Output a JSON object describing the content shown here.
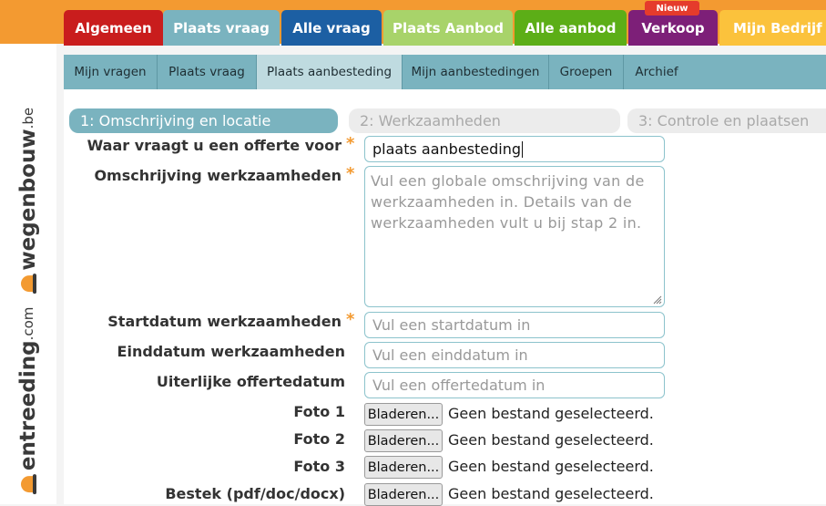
{
  "logo": {
    "part1": "entreeding",
    "part1_ext": ".com",
    "part2": "wegenbouw",
    "part2_ext": ".be"
  },
  "main_tabs": [
    {
      "label": "Algemeen",
      "color": "#c91d1d"
    },
    {
      "label": "Plaats vraag",
      "color": "#7ab3bf"
    },
    {
      "label": "Alle vraag",
      "color": "#1c5fa3"
    },
    {
      "label": "Plaats Aanbod",
      "color": "#a8d36a"
    },
    {
      "label": "Alle aanbod",
      "color": "#5cae17"
    },
    {
      "label": "Verkoop",
      "color": "#7d1f78"
    },
    {
      "label": "Mijn Bedrijf",
      "color": "#fbc23c"
    }
  ],
  "new_badge": "Nieuw",
  "sub_nav": [
    {
      "label": "Mijn vragen",
      "active": false
    },
    {
      "label": "Plaats vraag",
      "active": false
    },
    {
      "label": "Plaats aanbesteding",
      "active": true
    },
    {
      "label": "Mijn aanbestedingen",
      "active": false
    },
    {
      "label": "Groepen",
      "active": false
    },
    {
      "label": "Archief",
      "active": false
    }
  ],
  "steps": [
    {
      "label": "1: Omschrijving en locatie",
      "active": true
    },
    {
      "label": "2: Werkzaamheden",
      "active": false
    },
    {
      "label": "3: Controle en plaatsen",
      "active": false
    }
  ],
  "form": {
    "required_mark": "*",
    "offerte_voor": {
      "label": "Waar vraagt u een offerte voor",
      "value": "plaats aanbesteding"
    },
    "omschrijving": {
      "label": "Omschrijving werkzaamheden",
      "placeholder": "Vul een globale omschrijving van de werkzaamheden in. Details van de werkzaamheden vult u bij stap 2 in."
    },
    "startdatum": {
      "label": "Startdatum werkzaamheden",
      "placeholder": "Vul een startdatum in"
    },
    "einddatum": {
      "label": "Einddatum werkzaamheden",
      "placeholder": "Vul een einddatum in"
    },
    "offertedatum": {
      "label": "Uiterlijke offertedatum",
      "placeholder": "Vul een offertedatum in"
    },
    "files": [
      {
        "label": "Foto 1",
        "button": "Bladeren...",
        "status": "Geen bestand geselecteerd."
      },
      {
        "label": "Foto 2",
        "button": "Bladeren...",
        "status": "Geen bestand geselecteerd."
      },
      {
        "label": "Foto 3",
        "button": "Bladeren...",
        "status": "Geen bestand geselecteerd."
      },
      {
        "label": "Bestek (pdf/doc/docx)",
        "button": "Bladeren...",
        "status": "Geen bestand geselecteerd."
      }
    ]
  }
}
